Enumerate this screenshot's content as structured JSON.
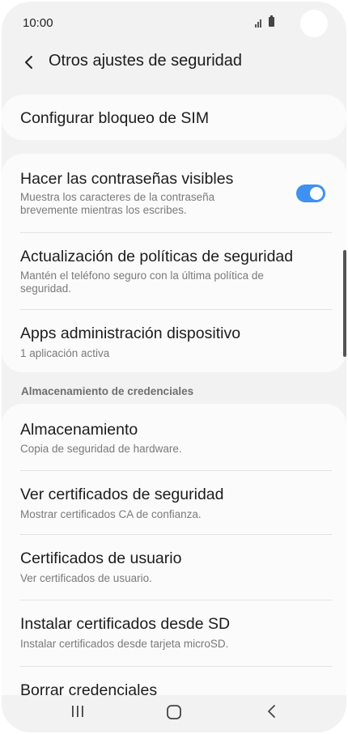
{
  "status_bar": {
    "time": "10:00"
  },
  "header": {
    "title": "Otros ajustes de seguridad",
    "back_icon": "chevron-left-icon"
  },
  "sim_lock": {
    "title": "Configurar bloqueo de SIM"
  },
  "main_items": [
    {
      "title": "Hacer las contraseñas visibles",
      "subtitle_line1": "Muestra los caracteres de la contraseña",
      "subtitle_line2": "brevemente mientras los escribes.",
      "toggle_on": true
    },
    {
      "title": "Actualización de políticas de seguridad",
      "subtitle_line1": "Mantén el teléfono seguro con la última política de",
      "subtitle_line2": "seguridad."
    },
    {
      "title": "Apps administración dispositivo",
      "subtitle": "1 aplicación activa"
    }
  ],
  "credentials_section": {
    "header": "Almacenamiento de credenciales",
    "items": [
      {
        "title": "Almacenamiento",
        "subtitle": "Copia de seguridad de hardware."
      },
      {
        "title": "Ver certificados de seguridad",
        "subtitle": "Mostrar certificados CA de confianza."
      },
      {
        "title": "Certificados de usuario",
        "subtitle": "Ver certificados de usuario."
      },
      {
        "title": "Instalar certificados desde SD",
        "subtitle": "Instalar certificados desde tarjeta microSD."
      },
      {
        "title": "Borrar credenciales"
      }
    ]
  },
  "nav_bar": {
    "recents_icon": "recents-icon",
    "home_icon": "home-icon",
    "back_icon": "back-icon"
  },
  "colors": {
    "accent": "#3e91f0",
    "background": "#f2f2f2",
    "card": "#fbfbfb"
  }
}
